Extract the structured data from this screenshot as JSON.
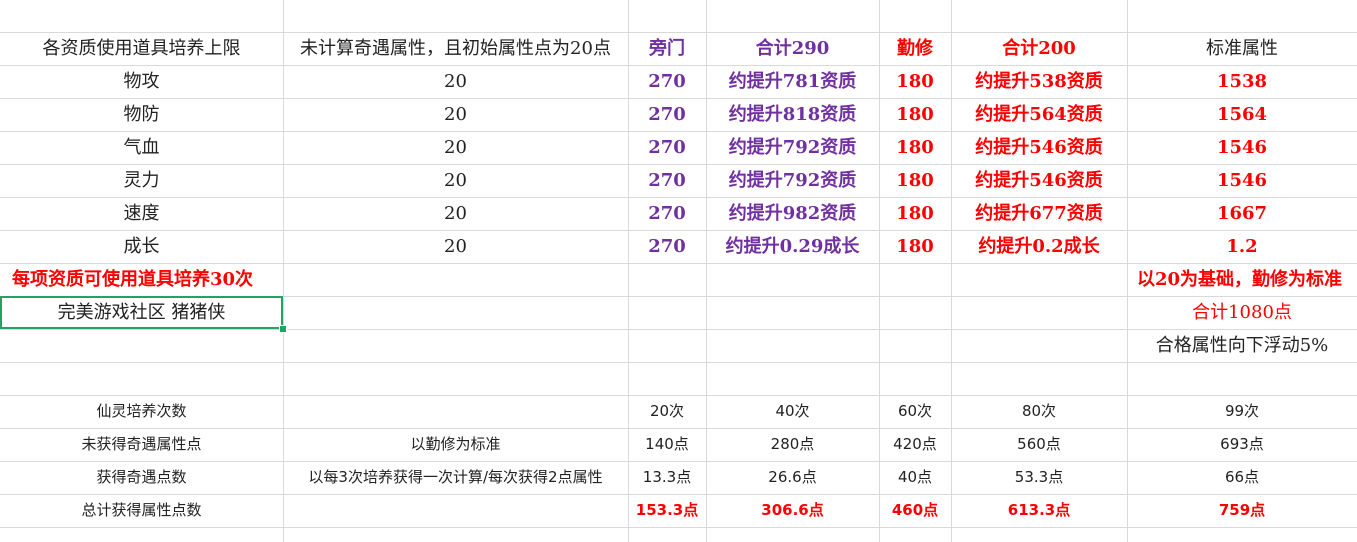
{
  "header": {
    "col_a": "各资质使用道具培养上限",
    "col_b": "未计算奇遇属性，且初始属性点为20点",
    "col_c": "旁门",
    "col_d": "合计290",
    "col_e": "勤修",
    "col_f": "合计200",
    "col_g": "标准属性"
  },
  "rows": [
    {
      "name": "物攻",
      "base": "20",
      "pangmen": "270",
      "pm_boost": "约提升781资质",
      "qinxiu": "180",
      "qx_boost": "约提升538资质",
      "standard": "1538"
    },
    {
      "name": "物防",
      "base": "20",
      "pangmen": "270",
      "pm_boost": "约提升818资质",
      "qinxiu": "180",
      "qx_boost": "约提升564资质",
      "standard": "1564"
    },
    {
      "name": "气血",
      "base": "20",
      "pangmen": "270",
      "pm_boost": "约提升792资质",
      "qinxiu": "180",
      "qx_boost": "约提升546资质",
      "standard": "1546"
    },
    {
      "name": "灵力",
      "base": "20",
      "pangmen": "270",
      "pm_boost": "约提升792资质",
      "qinxiu": "180",
      "qx_boost": "约提升546资质",
      "standard": "1546"
    },
    {
      "name": "速度",
      "base": "20",
      "pangmen": "270",
      "pm_boost": "约提升982资质",
      "qinxiu": "180",
      "qx_boost": "约提升677资质",
      "standard": "1667"
    },
    {
      "name": "成长",
      "base": "20",
      "pangmen": "270",
      "pm_boost": "约提升0.29成长",
      "qinxiu": "180",
      "qx_boost": "约提升0.2成长",
      "standard": "1.2"
    }
  ],
  "notes": {
    "per_item_limit": "每项资质可使用道具培养30次",
    "basis_note": "以20为基础，勤修为标准",
    "community": "完美游戏社区  猪猪侠",
    "total_points": "合计1080点",
    "tolerance": "合格属性向下浮动5%"
  },
  "bottom": {
    "row1": {
      "label": "仙灵培养次数",
      "note": "",
      "c": "20次",
      "d": "40次",
      "e": "60次",
      "f": "80次",
      "g": "99次"
    },
    "row2": {
      "label": "未获得奇遇属性点",
      "note": "以勤修为标准",
      "c": "140点",
      "d": "280点",
      "e": "420点",
      "f": "560点",
      "g": "693点"
    },
    "row3": {
      "label": "获得奇遇点数",
      "note": "以每3次培养获得一次计算/每次获得2点属性",
      "c": "13.3点",
      "d": "26.6点",
      "e": "40点",
      "f": "53.3点",
      "g": "66点"
    },
    "row4": {
      "label": "总计获得属性点数",
      "note": "",
      "c": "153.3点",
      "d": "306.6点",
      "e": "460点",
      "f": "613.3点",
      "g": "759点"
    }
  },
  "colors": {
    "purple": "#7030a0",
    "red": "#ff0000",
    "selection": "#21a366",
    "grid": "#d9d9d9"
  }
}
